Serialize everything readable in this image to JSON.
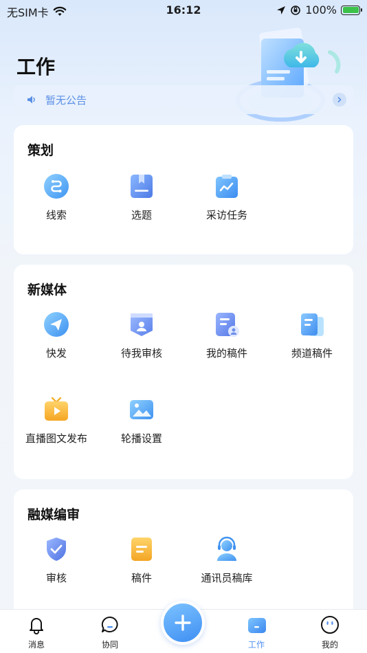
{
  "status_bar": {
    "carrier": "无SIM卡",
    "time": "16:12",
    "battery": "100%"
  },
  "page": {
    "title": "工作",
    "notice": "暂无公告"
  },
  "sections": [
    {
      "title": "策划",
      "items": [
        {
          "label": "线索",
          "icon": "clue-icon"
        },
        {
          "label": "选题",
          "icon": "topic-icon"
        },
        {
          "label": "采访任务",
          "icon": "interview-task-icon"
        }
      ]
    },
    {
      "title": "新媒体",
      "items": [
        {
          "label": "快发",
          "icon": "quick-send-icon"
        },
        {
          "label": "待我审核",
          "icon": "pending-review-icon"
        },
        {
          "label": "我的稿件",
          "icon": "my-manuscript-icon"
        },
        {
          "label": "频道稿件",
          "icon": "channel-manuscript-icon"
        },
        {
          "label": "直播图文发布",
          "icon": "live-publish-icon"
        },
        {
          "label": "轮播设置",
          "icon": "carousel-settings-icon"
        }
      ]
    },
    {
      "title": "融媒编审",
      "items": [
        {
          "label": "审核",
          "icon": "review-shield-icon"
        },
        {
          "label": "稿件",
          "icon": "manuscript-icon"
        },
        {
          "label": "通讯员稿库",
          "icon": "correspondent-library-icon"
        }
      ]
    }
  ],
  "tabbar": {
    "items": [
      {
        "label": "消息",
        "icon": "bell-icon",
        "active": false
      },
      {
        "label": "协同",
        "icon": "chat-icon",
        "active": false
      },
      {
        "label": "工作",
        "icon": "work-icon",
        "active": true
      },
      {
        "label": "我的",
        "icon": "profile-icon",
        "active": false
      }
    ]
  },
  "colors": {
    "accent": "#4f8ff0",
    "card_bg": "#ffffff",
    "notice_text": "#5b8fe6"
  }
}
